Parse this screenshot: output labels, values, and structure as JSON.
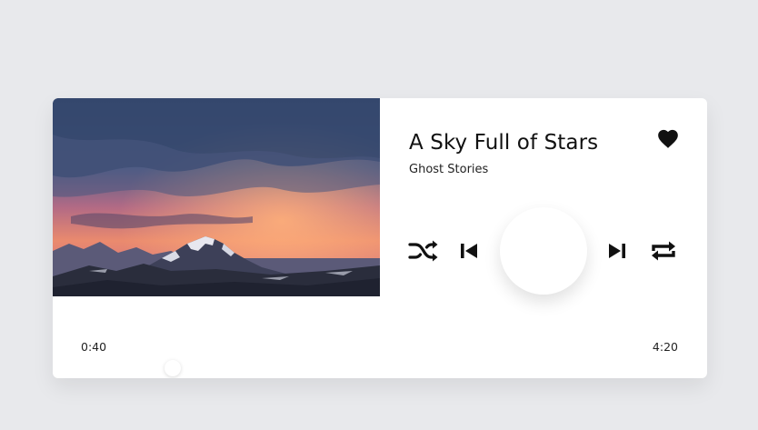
{
  "player": {
    "track_title": "A Sky Full of Stars",
    "album": "Ghost Stories",
    "liked": true,
    "time_current": "0:40",
    "time_total": "4:20",
    "progress_fraction": 0.154
  },
  "icons": {
    "like": "heart-icon",
    "shuffle": "shuffle-icon",
    "previous": "skip-previous-icon",
    "play": "play-button",
    "next": "skip-next-icon",
    "repeat": "repeat-icon"
  },
  "colors": {
    "background": "#e8e9ec",
    "card": "#ffffff",
    "icon": "#111111",
    "text": "#111111"
  }
}
